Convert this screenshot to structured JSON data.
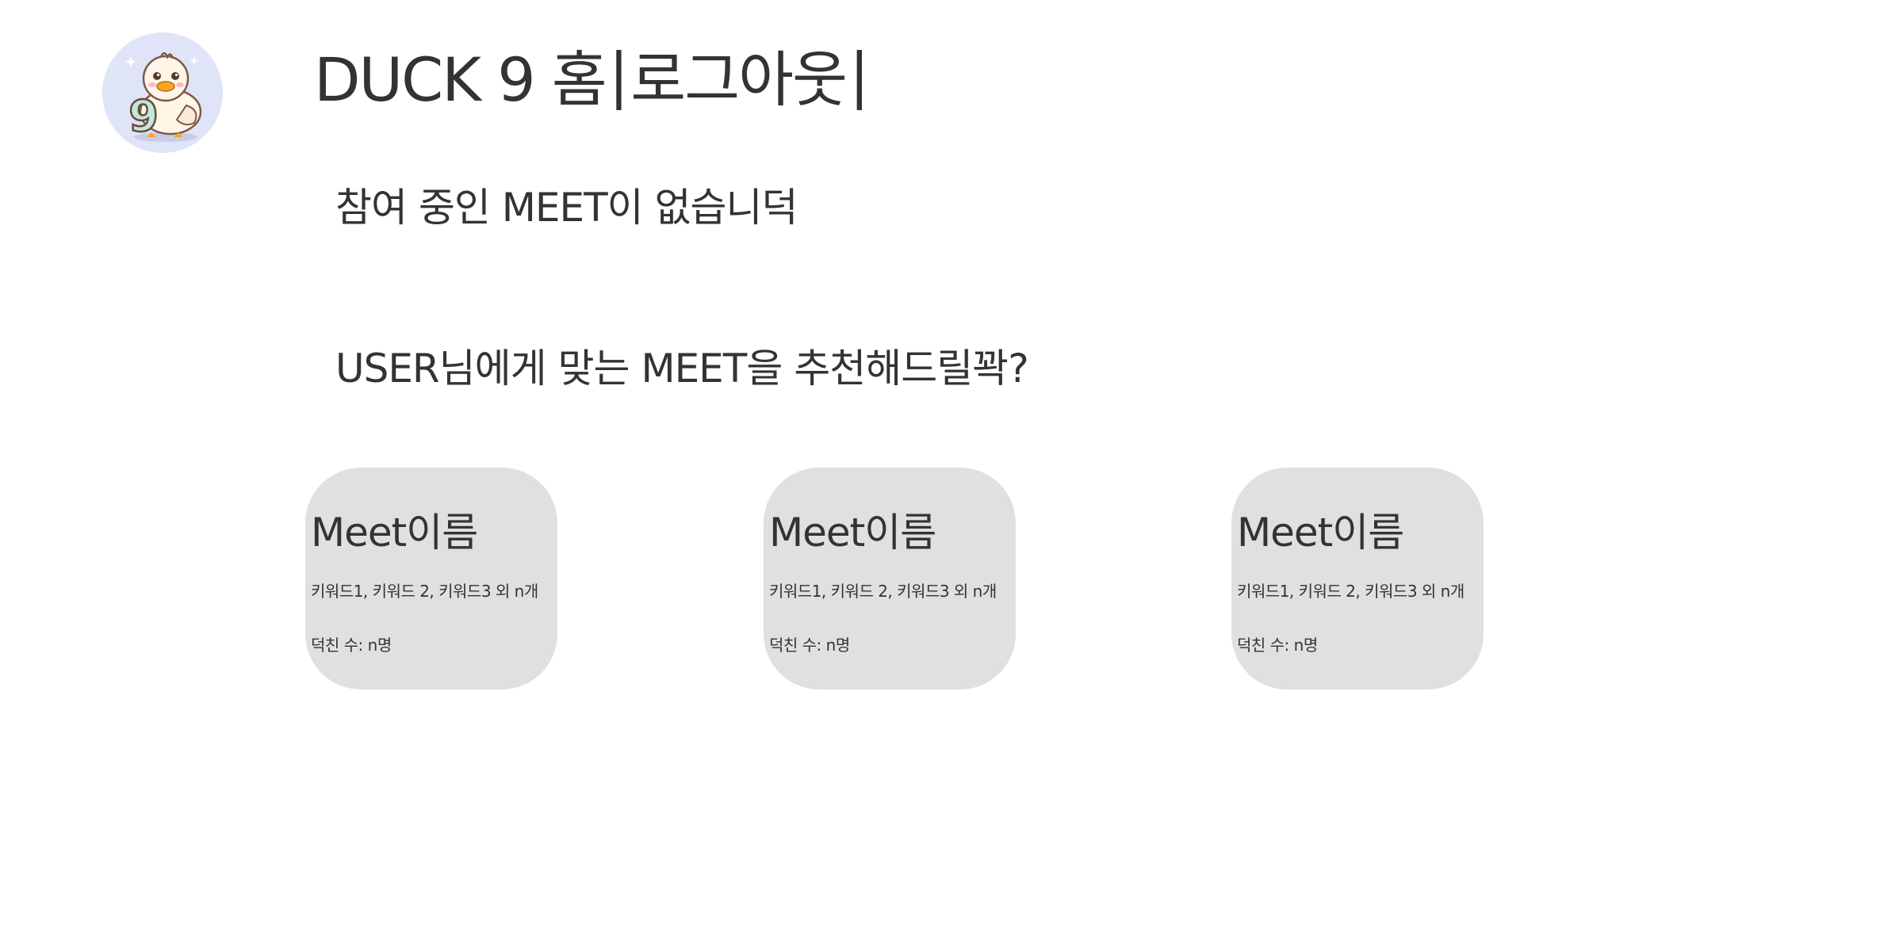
{
  "header": {
    "app_title": "DUCK 9 홈",
    "separator_left": "|",
    "logout_label": "로그아웃",
    "separator_right": "|"
  },
  "logo": {
    "icon": "duck-mascot-icon",
    "badge_text": "9",
    "bg_color": "#dfe4f8"
  },
  "status": {
    "no_meet_text": "참여 중인 MEET이 없습니덕"
  },
  "recommend": {
    "heading": "USER님에게 맞는 MEET을 추천해드릴꽉?"
  },
  "cards": [
    {
      "name": "Meet이름",
      "keywords": "키워드1, 키워드 2, 키워드3 외 n개",
      "member_count": "덕친 수: n명"
    },
    {
      "name": "Meet이름",
      "keywords": "키워드1, 키워드 2, 키워드3 외 n개",
      "member_count": "덕친 수: n명"
    },
    {
      "name": "Meet이름",
      "keywords": "키워드1, 키워드 2, 키워드3 외 n개",
      "member_count": "덕친 수: n명"
    }
  ],
  "colors": {
    "text": "#333333",
    "card_bg": "#e0e0e0",
    "page_bg": "#ffffff"
  }
}
